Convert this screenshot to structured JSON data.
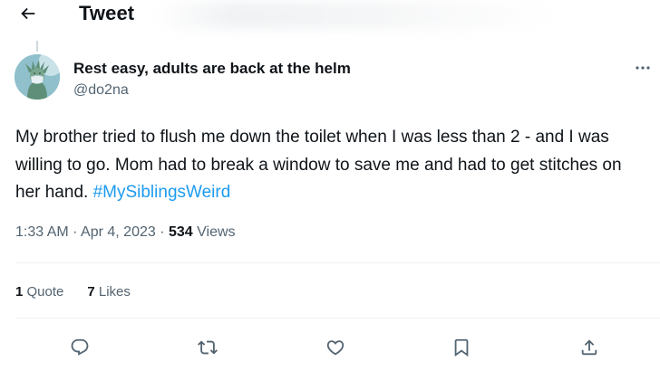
{
  "header": {
    "title": "Tweet",
    "back_icon": "arrow-left-icon"
  },
  "tweet": {
    "author_name": "Rest easy, adults are back at the helm",
    "author_handle": "@do2na",
    "text": "My brother tried to flush me down the toilet when I was less than 2 - and I was willing to go. Mom had to break a window to save me and had to get stitches on her hand. ",
    "hashtag": "#MySiblingsWeird",
    "time": "1:33 AM",
    "sep1": " · ",
    "date": "Apr 4, 2023",
    "sep2": " · ",
    "views_count": "534",
    "views_label": " Views"
  },
  "stats": {
    "quotes_count": "1",
    "quotes_label": " Quote",
    "likes_count": "7",
    "likes_label": " Likes"
  },
  "actions": {
    "reply_icon": "reply-icon",
    "retweet_icon": "retweet-icon",
    "like_icon": "heart-icon",
    "bookmark_icon": "bookmark-icon",
    "share_icon": "share-icon"
  },
  "colors": {
    "text": "#0f1419",
    "secondary": "#536471",
    "link": "#1d9bf0",
    "divider": "#eff3f4"
  }
}
